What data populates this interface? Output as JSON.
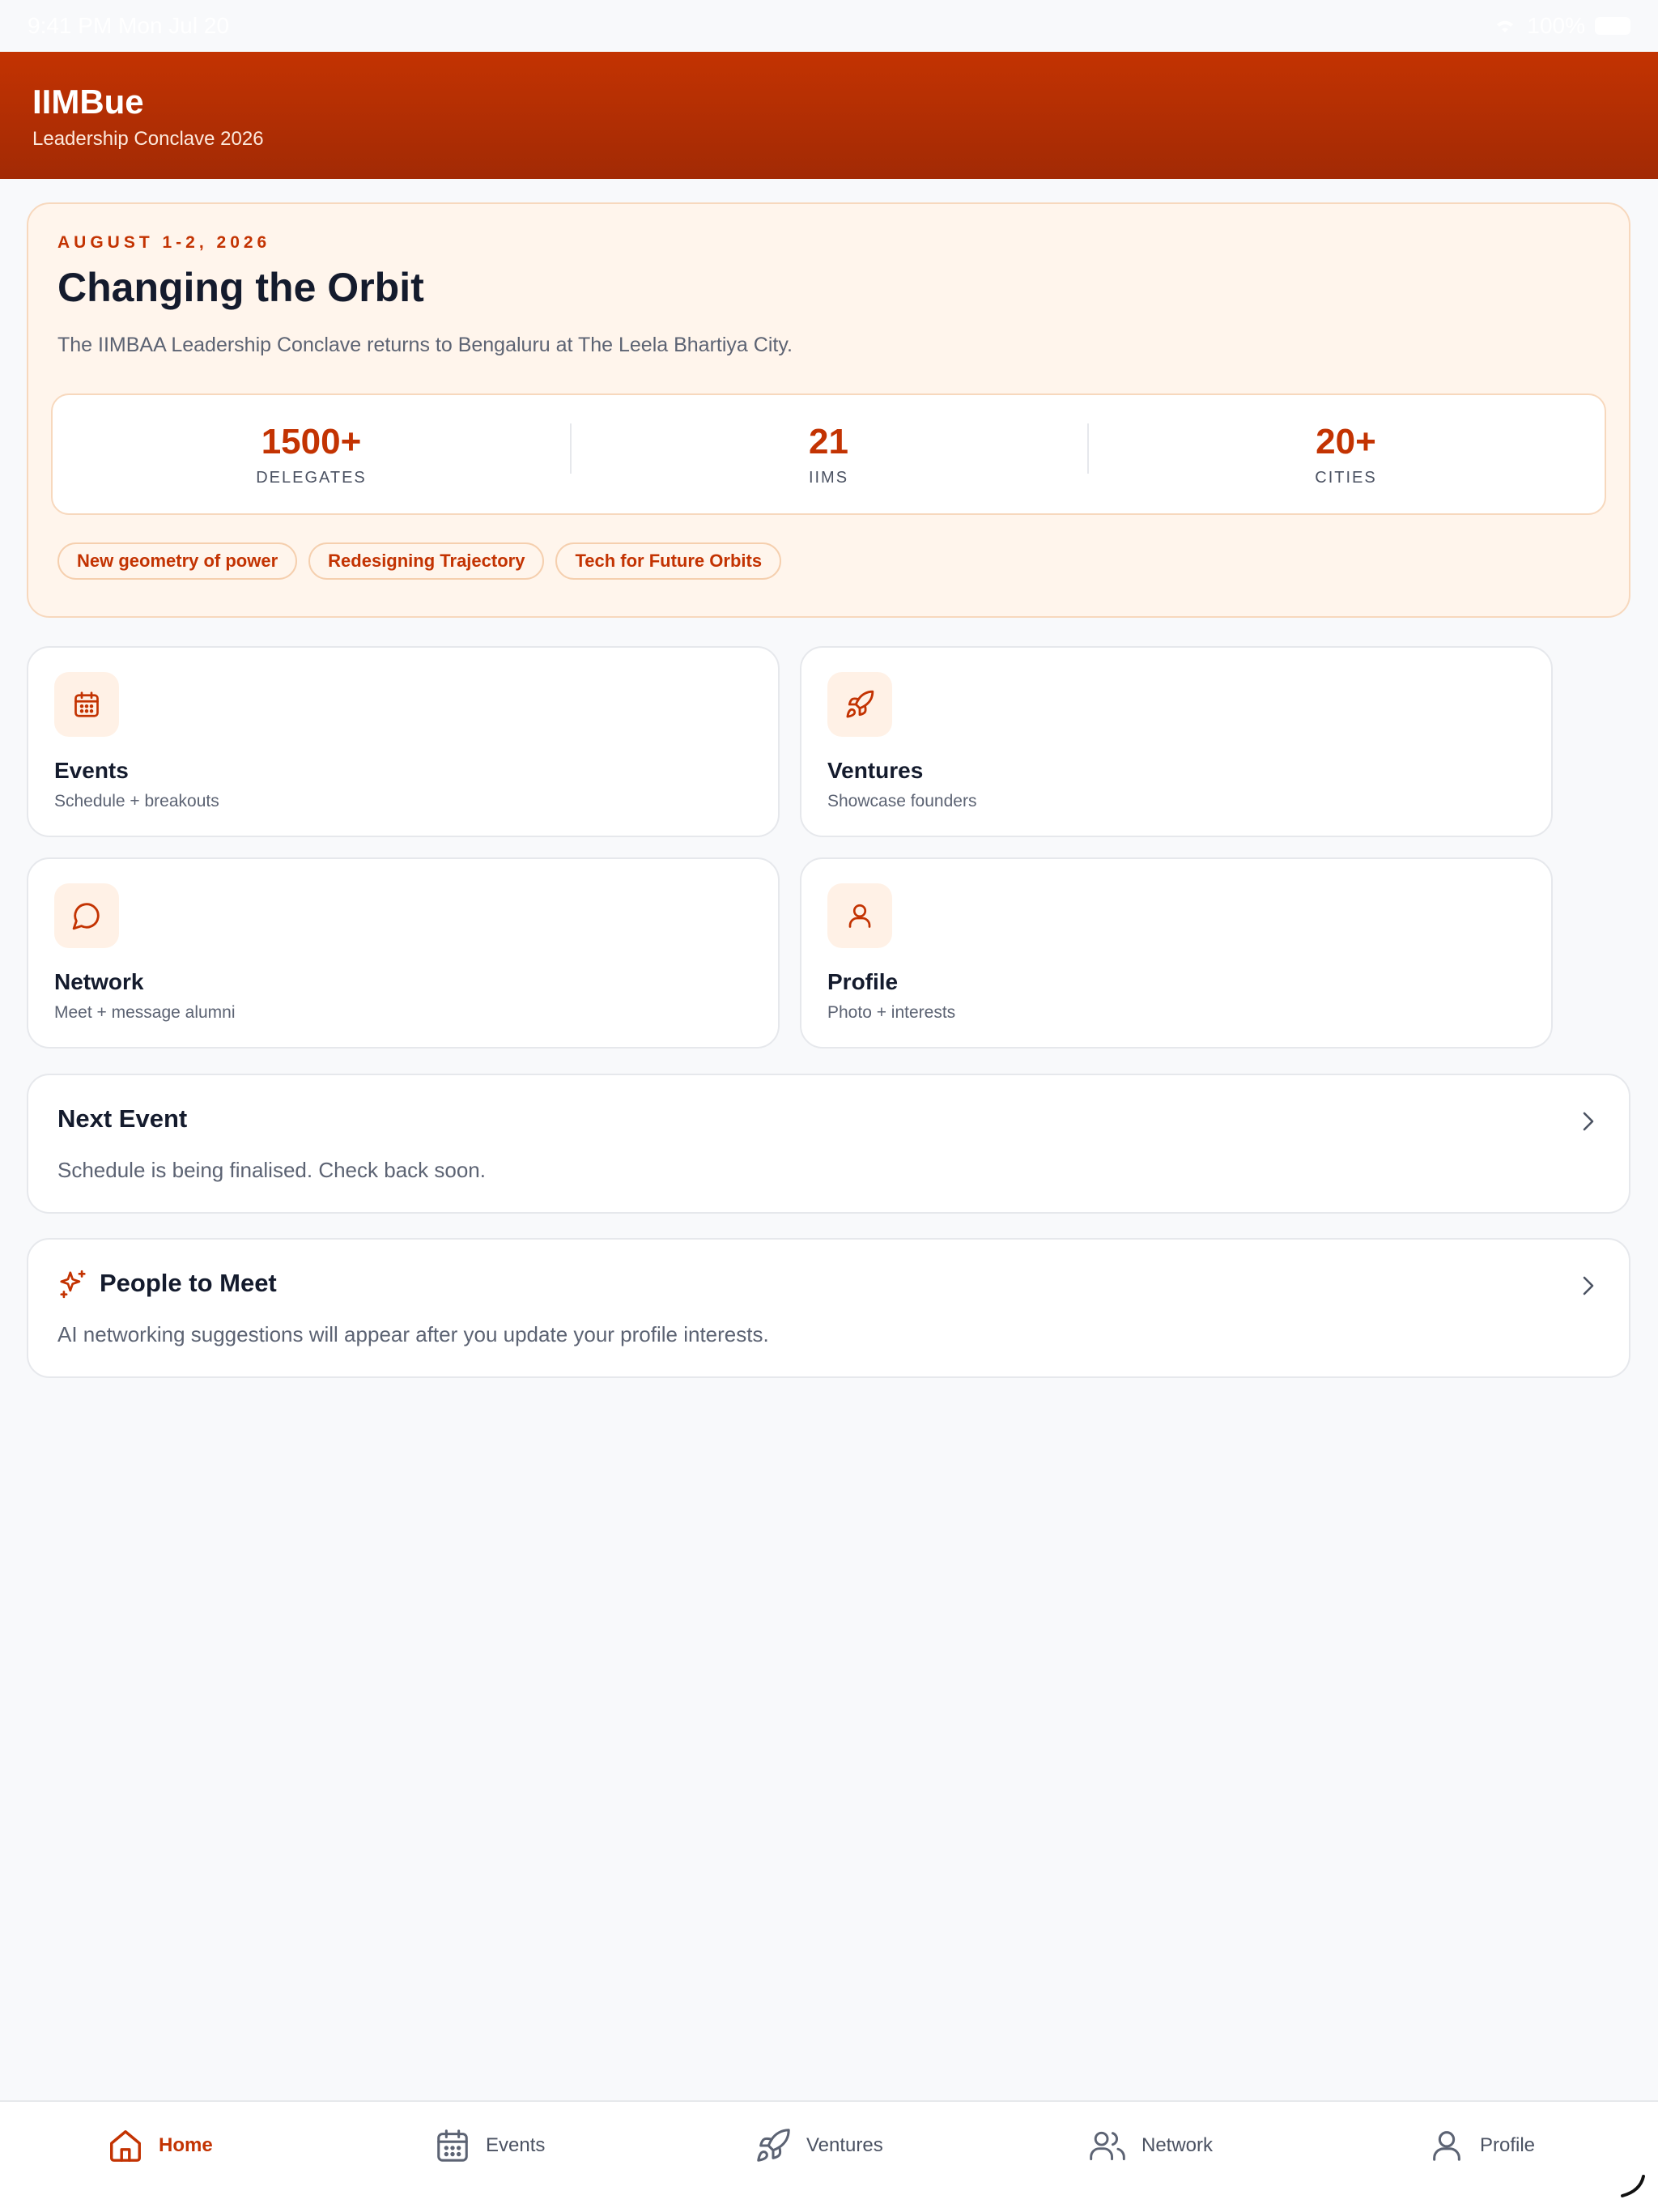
{
  "status_bar": {
    "time": "9:41 PM  Mon Jul 20",
    "battery": "100%"
  },
  "header": {
    "title": "IIMBue",
    "subtitle": "Leadership Conclave 2026"
  },
  "hero": {
    "date": "AUGUST 1-2, 2026",
    "title": "Changing the Orbit",
    "description": "The IIMBAA Leadership Conclave returns to Bengaluru at The Leela Bhartiya City.",
    "stats": [
      {
        "value": "1500+",
        "label": "DELEGATES"
      },
      {
        "value": "21",
        "label": "IIMS"
      },
      {
        "value": "20+",
        "label": "CITIES"
      }
    ],
    "tags": [
      "New geometry of power",
      "Redesigning Trajectory",
      "Tech for Future Orbits"
    ]
  },
  "tiles": [
    {
      "title": "Events",
      "subtitle": "Schedule + breakouts",
      "icon": "calendar-icon"
    },
    {
      "title": "Ventures",
      "subtitle": "Showcase founders",
      "icon": "rocket-icon"
    },
    {
      "title": "Network",
      "subtitle": "Meet + message alumni",
      "icon": "chat-icon"
    },
    {
      "title": "Profile",
      "subtitle": "Photo + interests",
      "icon": "user-icon"
    }
  ],
  "next_event": {
    "title": "Next Event",
    "body": "Schedule is being finalised. Check back soon."
  },
  "people_to_meet": {
    "title": "People to Meet",
    "body": "AI networking suggestions will appear after you update your profile interests."
  },
  "tabbar": [
    {
      "label": "Home",
      "icon": "home-icon",
      "active": true
    },
    {
      "label": "Events",
      "icon": "calendar-icon",
      "active": false
    },
    {
      "label": "Ventures",
      "icon": "rocket-icon",
      "active": false
    },
    {
      "label": "Network",
      "icon": "users-icon",
      "active": false
    },
    {
      "label": "Profile",
      "icon": "user-icon",
      "active": false
    }
  ],
  "colors": {
    "accent": "#c33302",
    "accent_soft": "#fff5ec",
    "text": "#141b2d",
    "muted": "#5c6373"
  }
}
